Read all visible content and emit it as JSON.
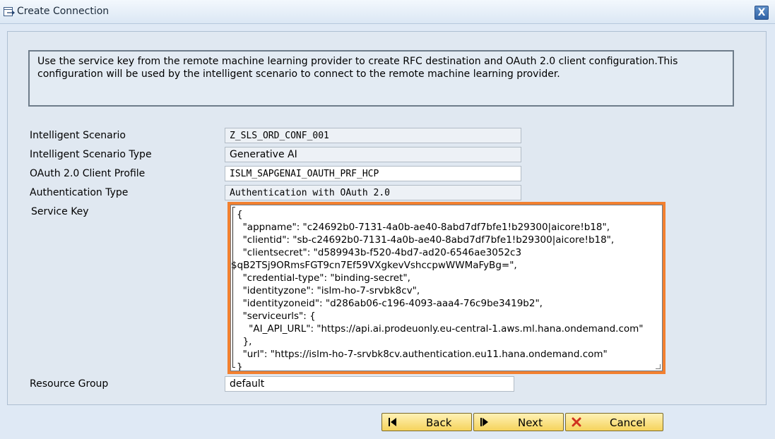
{
  "window": {
    "title": "Create Connection",
    "close_label": "X"
  },
  "description": "Use the service key from the remote machine learning provider to create RFC destination and OAuth 2.0 client configuration.This configuration will be used by the intelligent scenario to connect to the remote machine learning provider.",
  "fields": {
    "intelligent_scenario": {
      "label": "Intelligent Scenario",
      "value": "Z_SLS_ORD_CONF_001"
    },
    "scenario_type": {
      "label": "Intelligent Scenario Type",
      "value": "Generative AI"
    },
    "oauth_profile": {
      "label": "OAuth 2.0 Client Profile",
      "value": "ISLM_SAPGENAI_OAUTH_PRF_HCP"
    },
    "auth_type": {
      "label": "Authentication Type",
      "value": "Authentication with OAuth 2.0"
    },
    "service_key": {
      "label": "Service Key",
      "lines": [
        "{",
        "  \"appname\": \"c24692b0-7131-4a0b-ae40-8abd7df7bfe1!b29300|aicore!b18\",",
        "  \"clientid\": \"sb-c24692b0-7131-4a0b-ae40-8abd7df7bfe1!b29300|aicore!b18\",",
        "  \"clientsecret\": \"d589943b-f520-4bd7-ad20-6546ae3052c3",
        "$qB2TSj9ORmsFGT9cn7Ef59VXgkevVshccpwWWMaFyBg=\",",
        "  \"credential-type\": \"binding-secret\",",
        "  \"identityzone\": \"islm-ho-7-srvbk8cv\",",
        "  \"identityzoneid\": \"d286ab06-c196-4093-aaa4-76c9be3419b2\",",
        "  \"serviceurls\": {",
        "    \"AI_API_URL\": \"https://api.ai.prodeuonly.eu-central-1.aws.ml.hana.ondemand.com\"",
        "  },",
        "  \"url\": \"https://islm-ho-7-srvbk8cv.authentication.eu11.hana.ondemand.com\"",
        "}"
      ]
    },
    "resource_group": {
      "label": "Resource Group",
      "value": "default"
    }
  },
  "buttons": {
    "back": "Back",
    "next": "Next",
    "cancel": "Cancel"
  },
  "colors": {
    "highlight": "#f28030",
    "button": "#f5d35c",
    "background": "#dfe9f5"
  }
}
